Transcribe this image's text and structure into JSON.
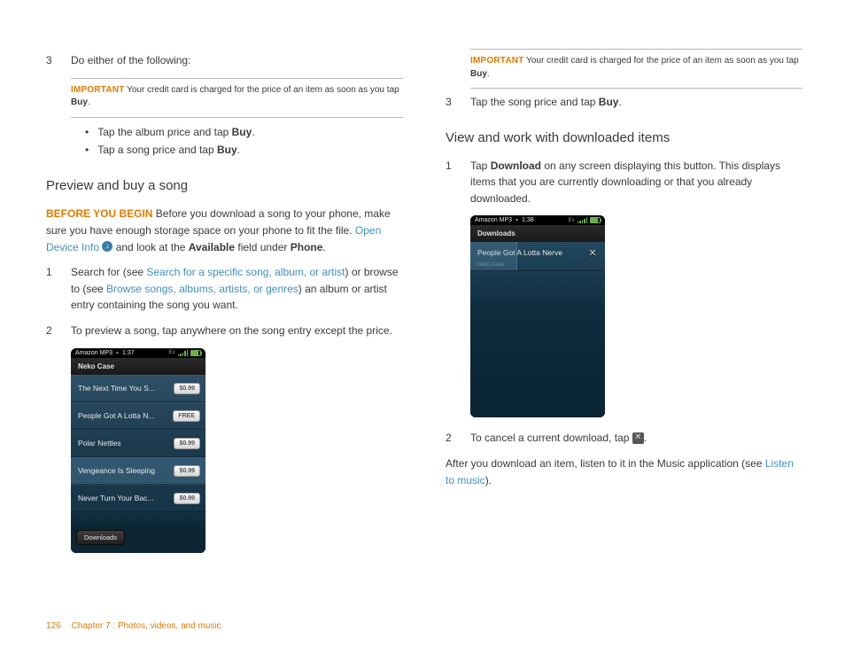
{
  "left": {
    "step3": {
      "num": "3",
      "text": "Do either of the following:"
    },
    "important": {
      "label": "IMPORTANT",
      "text_a": "  Your credit card is charged for the price of an item as soon as you tap ",
      "bold": "Buy",
      "text_b": "."
    },
    "bullets": {
      "b1_a": "Tap the album price and tap ",
      "b1_bold": "Buy",
      "b1_b": ".",
      "b2_a": "Tap a song price and tap ",
      "b2_bold": "Buy",
      "b2_b": "."
    },
    "section": "Preview and buy a song",
    "begin": {
      "label": "BEFORE YOU BEGIN",
      "t1": "  Before you download a song to your phone, make sure you have enough storage space on your phone to fit the file. ",
      "link": "Open Device Info",
      "t2": " ",
      "t3": " and look at the ",
      "bold1": "Available",
      "t4": " field under ",
      "bold2": "Phone",
      "t5": "."
    },
    "s1": {
      "num": "1",
      "a": "Search for (see ",
      "link1": "Search for a specific song, album, or artist",
      "b": ") or browse to (see ",
      "link2": "Browse songs, albums, artists, or genres",
      "c": ") an album or artist entry containing the song you want."
    },
    "s2": {
      "num": "2",
      "text": "To preview a song, tap anywhere on the song entry except the price."
    },
    "phone1": {
      "app": "Amazon MP3",
      "time": "1:37",
      "header": "Neko Case",
      "rows": [
        {
          "name": "The Next Time You S...",
          "price": "$0.99"
        },
        {
          "name": "People Got A Lotta N...",
          "price": "FREE"
        },
        {
          "name": "Polar Nettles",
          "price": "$0.99"
        },
        {
          "name": "Vengeance Is Sleeping",
          "price": "$0.99",
          "sel": true
        },
        {
          "name": "Never Turn Your Bac...",
          "price": "$0.99"
        }
      ],
      "dlbtn": "Downloads"
    }
  },
  "right": {
    "important": {
      "label": "IMPORTANT",
      "text_a": "  Your credit card is charged for the price of an item as soon as you tap ",
      "bold": "Buy",
      "text_b": "."
    },
    "step3": {
      "num": "3",
      "a": "Tap the song price and tap ",
      "bold": "Buy",
      "b": "."
    },
    "section": "View and work with downloaded items",
    "s1": {
      "num": "1",
      "a": "Tap ",
      "bold": "Download",
      "b": " on any screen displaying this button. This displays items that you are currently downloading or that you already downloaded."
    },
    "phone2": {
      "app": "Amazon MP3",
      "time": "1:38",
      "header": "Downloads",
      "row_name": "People Got A Lotta Nerve",
      "row_sub": "Neko Case"
    },
    "s2": {
      "num": "2",
      "a": "To cancel a current download, tap ",
      "b": "."
    },
    "after": {
      "a": "After you download an item, listen to it in the Music application (see ",
      "link": "Listen to music",
      "b": ")."
    }
  },
  "footer": {
    "page": "126",
    "chapter": "Chapter 7 : Photos, videos, and music"
  }
}
